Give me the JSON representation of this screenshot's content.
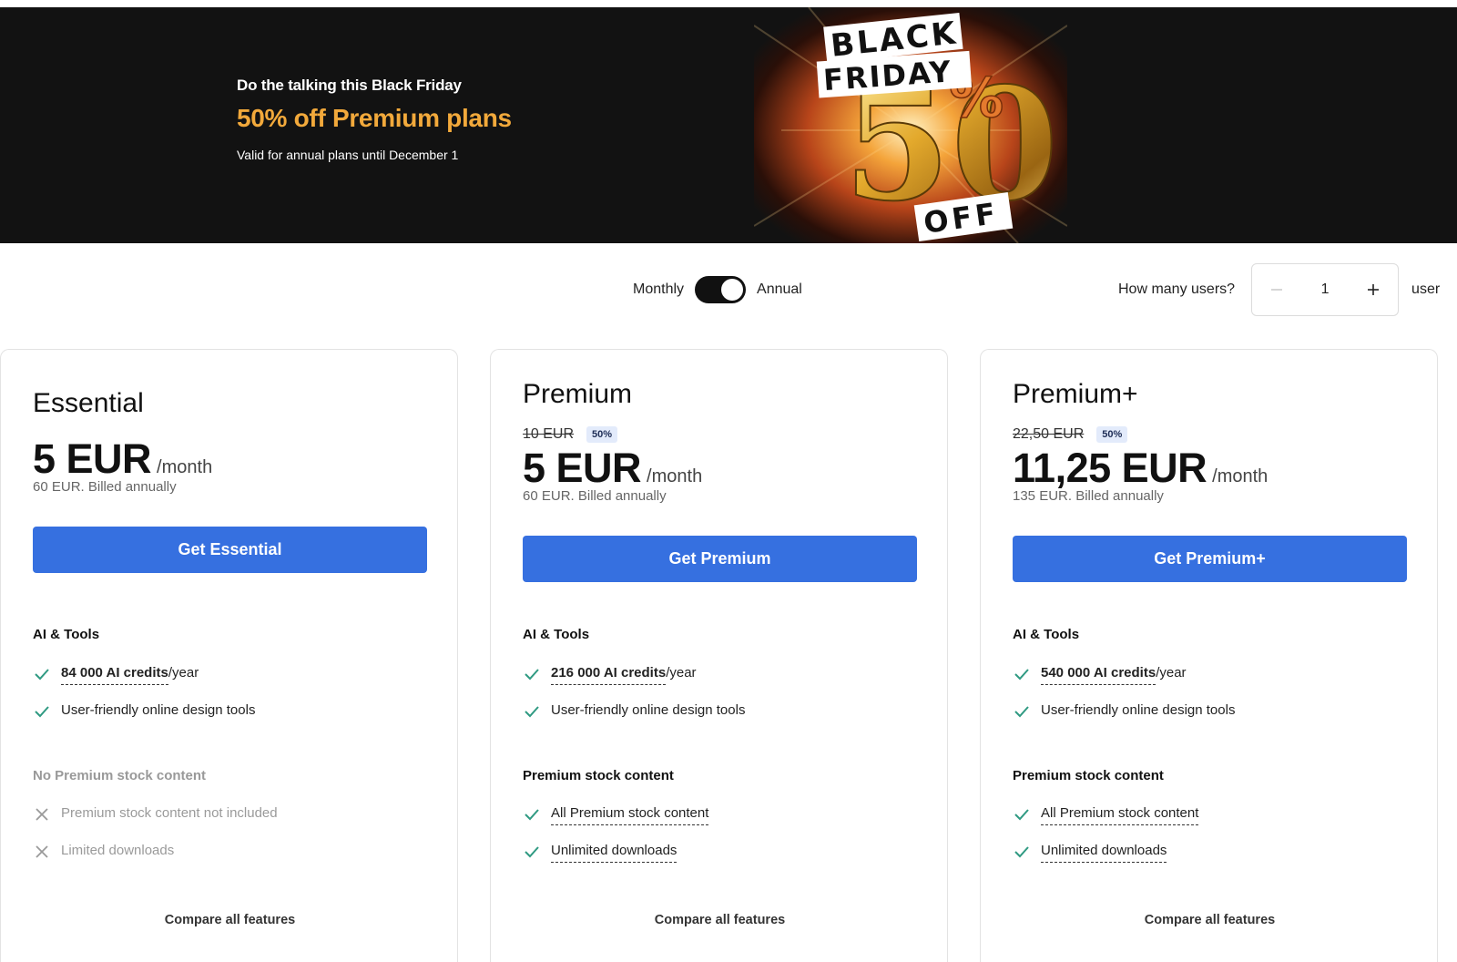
{
  "banner": {
    "eyebrow": "Do the talking this Black Friday",
    "headline": "50% off Premium plans",
    "note": "Valid for annual plans until December 1",
    "art": {
      "word1": "BLACK",
      "word2": "FRIDAY",
      "big": "50",
      "percent": "%",
      "off": "OFF",
      "accent_color": "#f2a93b"
    }
  },
  "billing": {
    "monthly_label": "Monthly",
    "annual_label": "Annual",
    "selected": "Annual"
  },
  "users": {
    "label": "How many users?",
    "value": "1",
    "unit": "user",
    "minus_icon": "minus-icon",
    "plus_icon": "plus-icon"
  },
  "plans": [
    {
      "name": "Essential",
      "price": "5 EUR",
      "per": "/month",
      "billed": "60 EUR. Billed annually",
      "cta": "Get Essential",
      "sections": [
        {
          "title": "AI & Tools",
          "included": true,
          "features": [
            {
              "bold": "84 000 AI credits",
              "rest": "/year",
              "included": true
            },
            {
              "bold": "",
              "rest": "User-friendly online design tools",
              "included": true
            }
          ]
        },
        {
          "title": "No Premium stock content",
          "included": false,
          "features": [
            {
              "bold": "",
              "rest": "Premium stock content not included",
              "included": false
            },
            {
              "bold": "",
              "rest": "Limited downloads",
              "included": false
            }
          ]
        }
      ],
      "compare": "Compare all features"
    },
    {
      "name": "Premium",
      "old_price": "10 EUR",
      "discount": "50%",
      "price": "5 EUR",
      "per": "/month",
      "billed": "60 EUR. Billed annually",
      "cta": "Get Premium",
      "sections": [
        {
          "title": "AI & Tools",
          "included": true,
          "features": [
            {
              "bold": "216 000 AI credits",
              "rest": "/year",
              "included": true
            },
            {
              "bold": "",
              "rest": "User-friendly online design tools",
              "included": true
            }
          ]
        },
        {
          "title": "Premium stock content",
          "included": true,
          "features": [
            {
              "bold": "",
              "rest": "All Premium stock content",
              "included": true
            },
            {
              "bold": "",
              "rest": "Unlimited downloads",
              "included": true
            }
          ]
        }
      ],
      "compare": "Compare all features"
    },
    {
      "name": "Premium+",
      "old_price": "22,50 EUR",
      "discount": "50%",
      "price": "11,25 EUR",
      "per": "/month",
      "billed": "135 EUR. Billed annually",
      "cta": "Get Premium+",
      "sections": [
        {
          "title": "AI & Tools",
          "included": true,
          "features": [
            {
              "bold": "540 000 AI credits",
              "rest": "/year",
              "included": true
            },
            {
              "bold": "",
              "rest": "User-friendly online design tools",
              "included": true
            }
          ]
        },
        {
          "title": "Premium stock content",
          "included": true,
          "features": [
            {
              "bold": "",
              "rest": "All Premium stock content",
              "included": true
            },
            {
              "bold": "",
              "rest": "Unlimited downloads",
              "included": true
            }
          ]
        }
      ],
      "compare": "Compare all features"
    }
  ],
  "colors": {
    "primary": "#3670e0",
    "check": "#2f9a82",
    "banner_bg": "#121212",
    "accent": "#f2a93b"
  }
}
